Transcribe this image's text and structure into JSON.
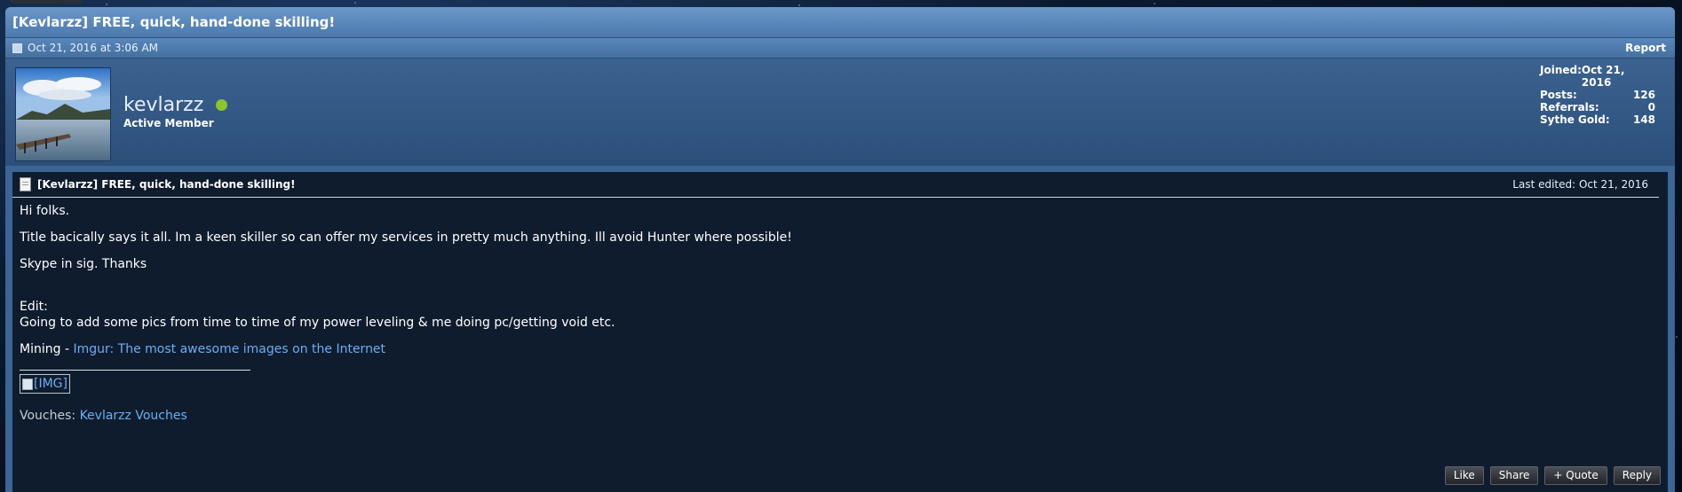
{
  "post": {
    "title": "[Kevlarzz] FREE, quick, hand-done skilling!",
    "timestamp": "Oct 21, 2016 at 3:06 AM",
    "report_label": "Report"
  },
  "user": {
    "name": "kevlarzz",
    "title": "Active Member",
    "online_color": "#8bc52a",
    "stats": [
      {
        "label": "Joined:",
        "value": "Oct 21, 2016"
      },
      {
        "label": "Posts:",
        "value": "126"
      },
      {
        "label": "Referrals:",
        "value": "0"
      },
      {
        "label": "Sythe Gold:",
        "value": "148"
      }
    ]
  },
  "content": {
    "title": "[Kevlarzz] FREE, quick, hand-done skilling!",
    "last_edited": "Last edited: Oct 21, 2016",
    "p1": "Hi folks.",
    "p2": "Title bacically says it all. Im a keen skiller so can offer my services in pretty much anything. Ill avoid Hunter where possible!",
    "p3": "Skype in sig. Thanks",
    "edit_label": "Edit:",
    "edit_text": "Going to add some pics from time to time of my power leveling & me doing pc/getting void etc.",
    "mining_label": "Mining - ",
    "mining_link": "Imgur: The most awesome images on the Internet",
    "img_placeholder": "[IMG]",
    "vouches_label": "Vouches: ",
    "vouches_link": "Kevlarzz Vouches"
  },
  "actions": {
    "like": "Like",
    "share": "Share",
    "quote": "+ Quote",
    "reply": "Reply"
  }
}
